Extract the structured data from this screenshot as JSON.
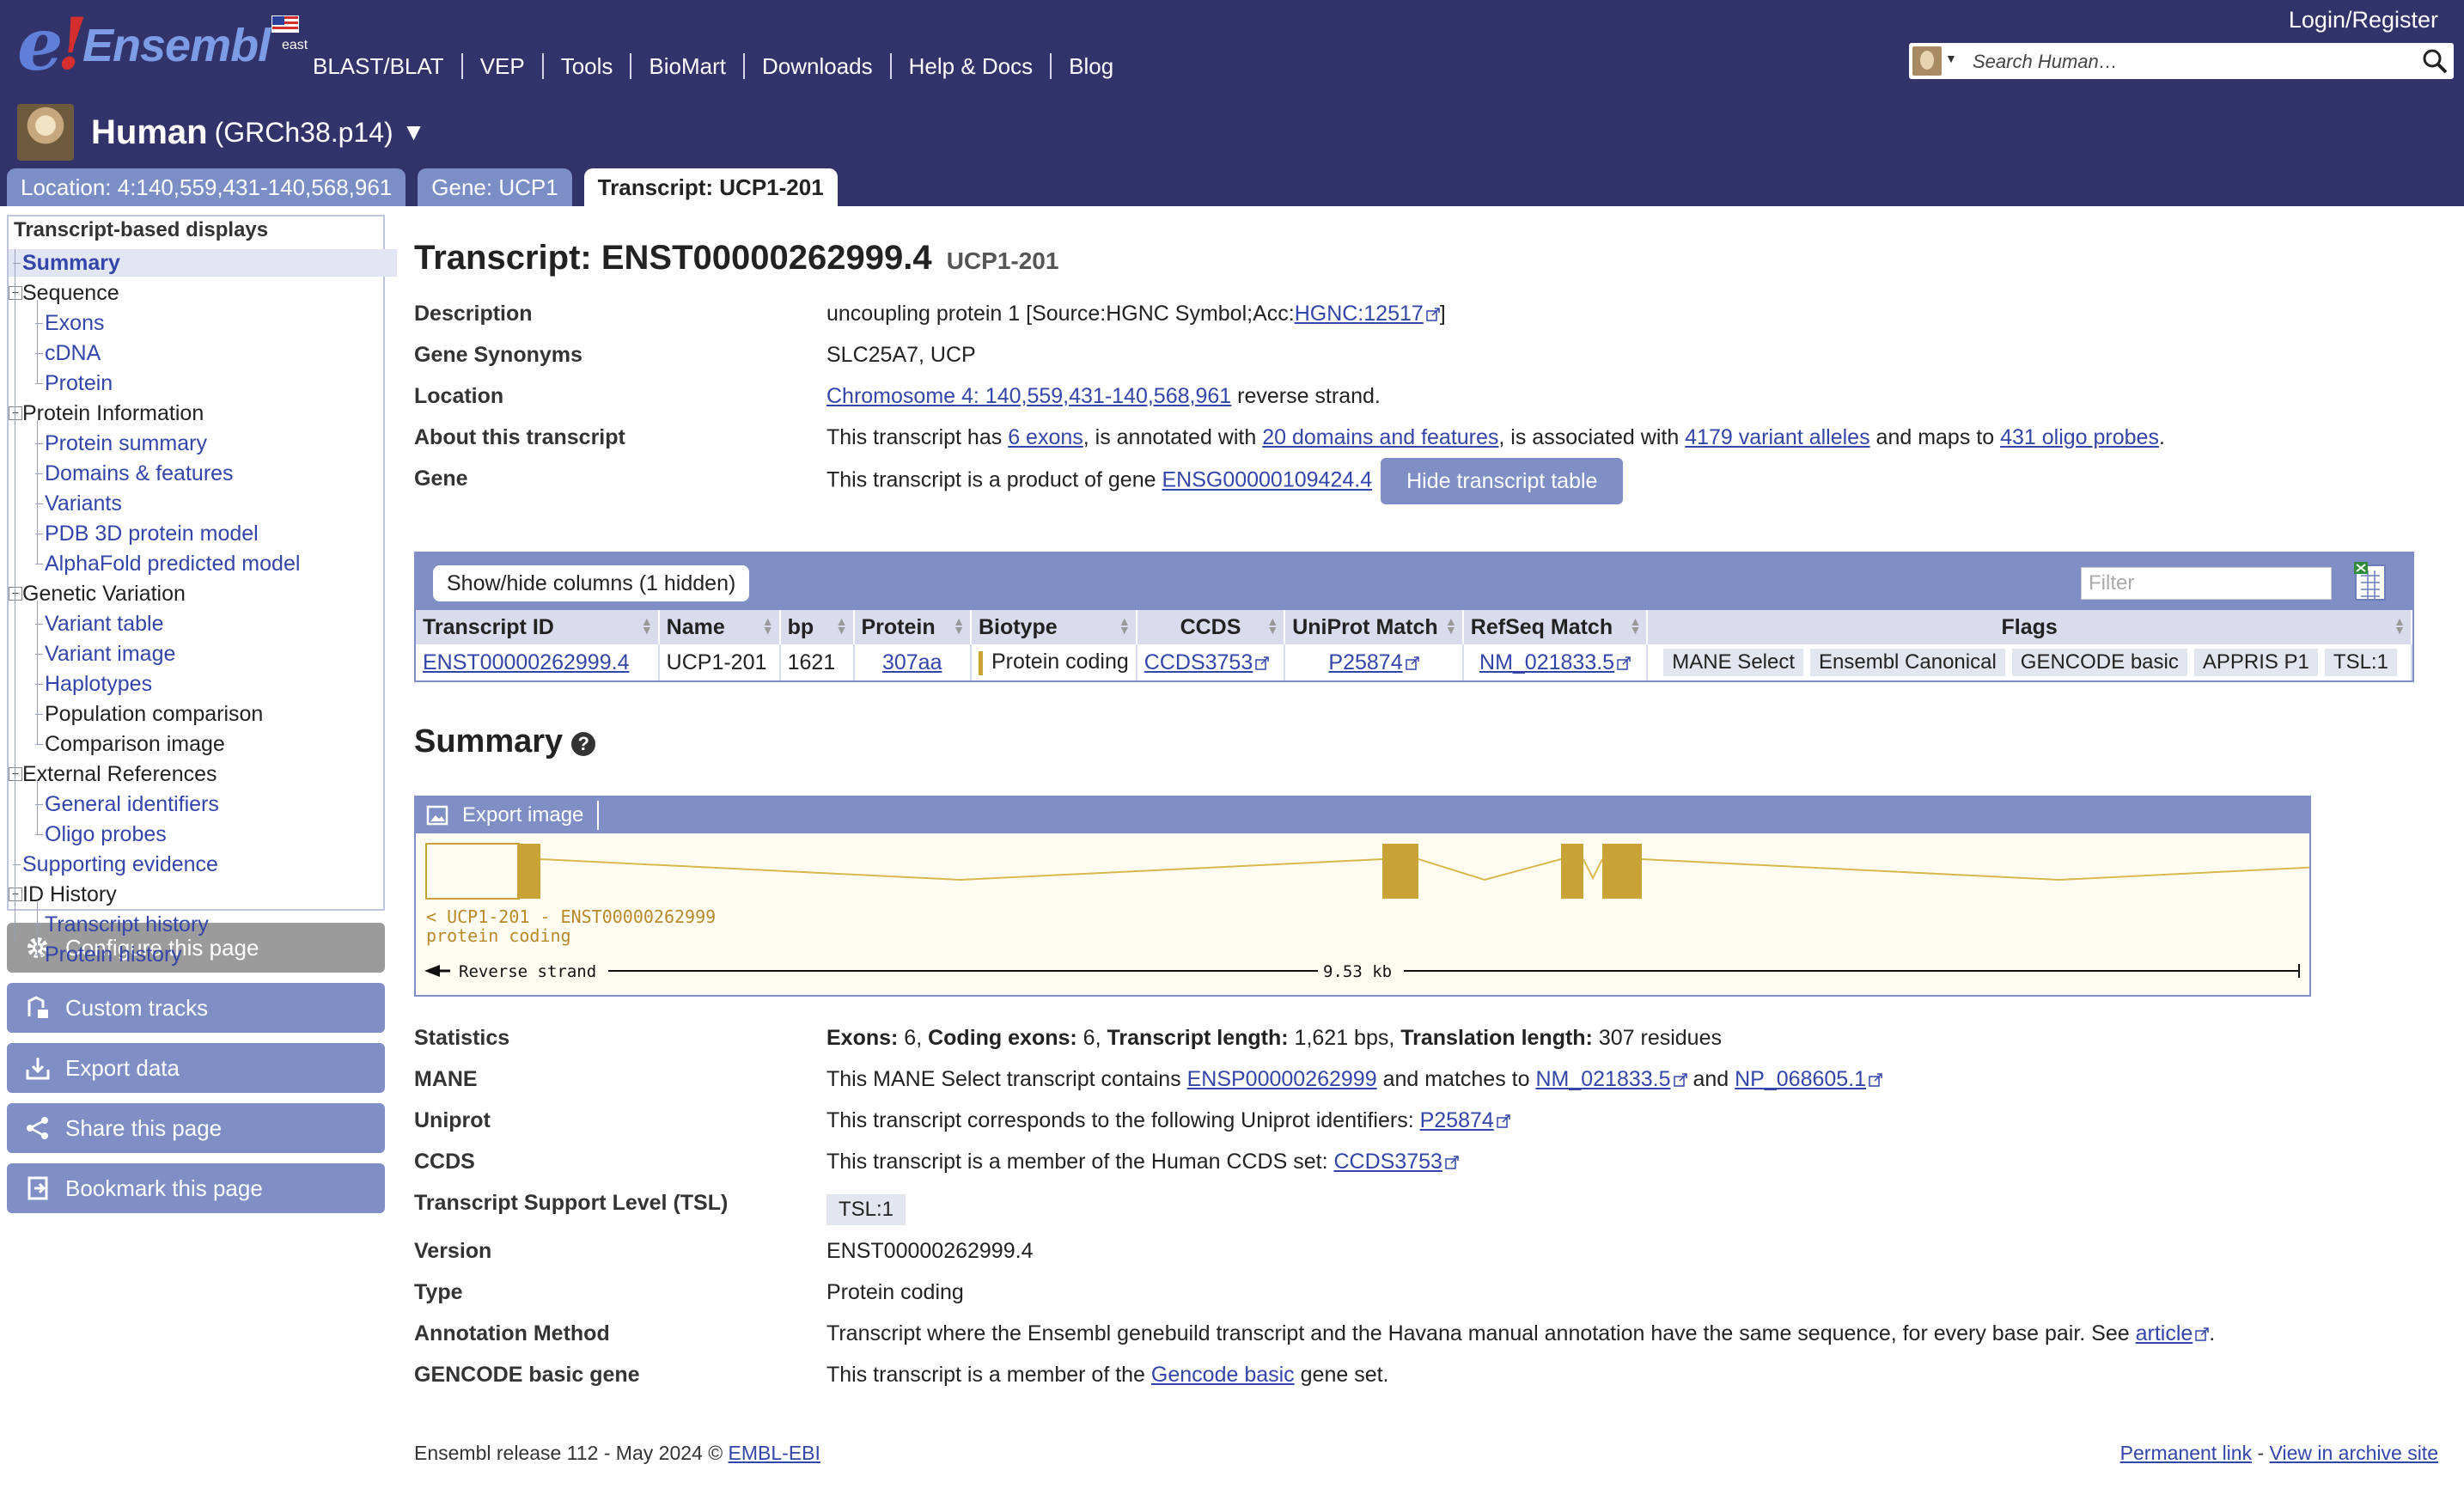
{
  "header": {
    "logo_text": "Ensembl",
    "logo_badge": "east",
    "nav": [
      "BLAST/BLAT",
      "VEP",
      "Tools",
      "BioMart",
      "Downloads",
      "Help & Docs",
      "Blog"
    ],
    "login": "Login/Register",
    "search_placeholder": "Search Human…",
    "species_name": "Human",
    "species_assembly": "(GRCh38.p14)",
    "species_caret": "▼"
  },
  "tabs": [
    {
      "label": "Location: 4:140,559,431-140,568,961",
      "active": false
    },
    {
      "label": "Gene: UCP1",
      "active": false
    },
    {
      "label": "Transcript: UCP1-201",
      "active": true
    }
  ],
  "sidebar": {
    "title": "Transcript-based displays",
    "items": [
      {
        "label": "Summary",
        "type": "selected"
      },
      {
        "label": "Sequence",
        "type": "plain"
      },
      {
        "label": "Exons",
        "type": "link"
      },
      {
        "label": "cDNA",
        "type": "link"
      },
      {
        "label": "Protein",
        "type": "link"
      },
      {
        "label": "Protein Information",
        "type": "plain"
      },
      {
        "label": "Protein summary",
        "type": "link"
      },
      {
        "label": "Domains & features",
        "type": "link"
      },
      {
        "label": "Variants",
        "type": "link"
      },
      {
        "label": "PDB 3D protein model",
        "type": "link"
      },
      {
        "label": "AlphaFold predicted model",
        "type": "link"
      },
      {
        "label": "Genetic Variation",
        "type": "plain"
      },
      {
        "label": "Variant table",
        "type": "link"
      },
      {
        "label": "Variant image",
        "type": "link"
      },
      {
        "label": "Haplotypes",
        "type": "link"
      },
      {
        "label": "Population comparison",
        "type": "plain"
      },
      {
        "label": "Comparison image",
        "type": "plain"
      },
      {
        "label": "External References",
        "type": "plain"
      },
      {
        "label": "General identifiers",
        "type": "link"
      },
      {
        "label": "Oligo probes",
        "type": "link"
      },
      {
        "label": "Supporting evidence",
        "type": "link"
      },
      {
        "label": "ID History",
        "type": "plain"
      },
      {
        "label": "Transcript history",
        "type": "link"
      },
      {
        "label": "Protein history",
        "type": "link"
      }
    ],
    "buttons": [
      "Configure this page",
      "Custom tracks",
      "Export data",
      "Share this page",
      "Bookmark this page"
    ]
  },
  "main": {
    "title": "Transcript: ENST00000262999.4",
    "title_sub": "UCP1-201",
    "description": {
      "label": "Description",
      "text_pre": "uncoupling protein 1 [Source:HGNC Symbol;Acc:",
      "link": "HGNC:12517",
      "text_post": "]"
    },
    "synonyms": {
      "label": "Gene Synonyms",
      "value": "SLC25A7, UCP"
    },
    "location": {
      "label": "Location",
      "link": "Chromosome 4: 140,559,431-140,568,961",
      "text_post": " reverse strand."
    },
    "about": {
      "label": "About this transcript",
      "t1": "This transcript has ",
      "l1": "6 exons",
      "t2": ", is annotated with ",
      "l2": "20 domains and features",
      "t3": ", is associated with ",
      "l3": "4179 variant alleles",
      "t4": " and maps to ",
      "l4": "431 oligo probes",
      "t5": "."
    },
    "gene": {
      "label": "Gene",
      "text_pre": "This transcript is a product of gene ",
      "link": "ENSG00000109424.4",
      "button": "Hide transcript table"
    }
  },
  "transcript_table": {
    "showhide": "Show/hide columns (1 hidden)",
    "filter_placeholder": "Filter",
    "columns": [
      "Transcript ID",
      "Name",
      "bp",
      "Protein",
      "Biotype",
      "CCDS",
      "UniProt Match",
      "RefSeq Match",
      "Flags"
    ],
    "row": {
      "transcript_id": "ENST00000262999.4",
      "name": "UCP1-201",
      "bp": "1621",
      "protein": "307aa",
      "biotype": "Protein coding",
      "ccds": "CCDS3753",
      "uniprot": "P25874",
      "refseq": "NM_021833.5",
      "flags": [
        "MANE Select",
        "Ensembl Canonical",
        "GENCODE basic",
        "APPRIS P1",
        "TSL:1"
      ]
    }
  },
  "summary": {
    "heading": "Summary",
    "help": "?",
    "export_image": "Export image",
    "track_label": "< UCP1-201 - ENST00000262999",
    "track_biotype": "protein coding",
    "strand_label": "Reverse strand",
    "scale_label": "9.53 kb",
    "colors": {
      "exon": "#caa338",
      "intron": "#d8b84e",
      "background": "#fffdf2"
    }
  },
  "stats": {
    "statistics": {
      "label": "Statistics",
      "b1": "Exons:",
      "v1": " 6, ",
      "b2": "Coding exons:",
      "v2": " 6, ",
      "b3": "Transcript length:",
      "v3": " 1,621 bps, ",
      "b4": "Translation length:",
      "v4": " 307 residues"
    },
    "mane": {
      "label": "MANE",
      "t1": "This MANE Select transcript contains ",
      "l1": "ENSP00000262999",
      "t2": " and matches to ",
      "l2": "NM_021833.5",
      "t3": " and ",
      "l3": "NP_068605.1"
    },
    "uniprot": {
      "label": "Uniprot",
      "t1": "This transcript corresponds to the following Uniprot identifiers: ",
      "l1": "P25874"
    },
    "ccds": {
      "label": "CCDS",
      "t1": "This transcript is a member of the Human CCDS set: ",
      "l1": "CCDS3753"
    },
    "tsl": {
      "label": "Transcript Support Level (TSL)",
      "value": "TSL:1"
    },
    "version": {
      "label": "Version",
      "value": "ENST00000262999.4"
    },
    "type": {
      "label": "Type",
      "value": "Protein coding"
    },
    "annotation": {
      "label": "Annotation Method",
      "t1": "Transcript where the Ensembl genebuild transcript and the Havana manual annotation have the same sequence, for every base pair. See ",
      "l1": "article",
      "t2": "."
    },
    "gencode": {
      "label": "GENCODE basic gene",
      "t1": "This transcript is a member of the ",
      "l1": "Gencode basic",
      "t2": " gene set."
    }
  },
  "footer": {
    "left_text": "Ensembl release 112 - May 2024 © ",
    "left_link": "EMBL-EBI",
    "permanent": "Permanent link",
    "sep": " - ",
    "archive": "View in archive site"
  }
}
